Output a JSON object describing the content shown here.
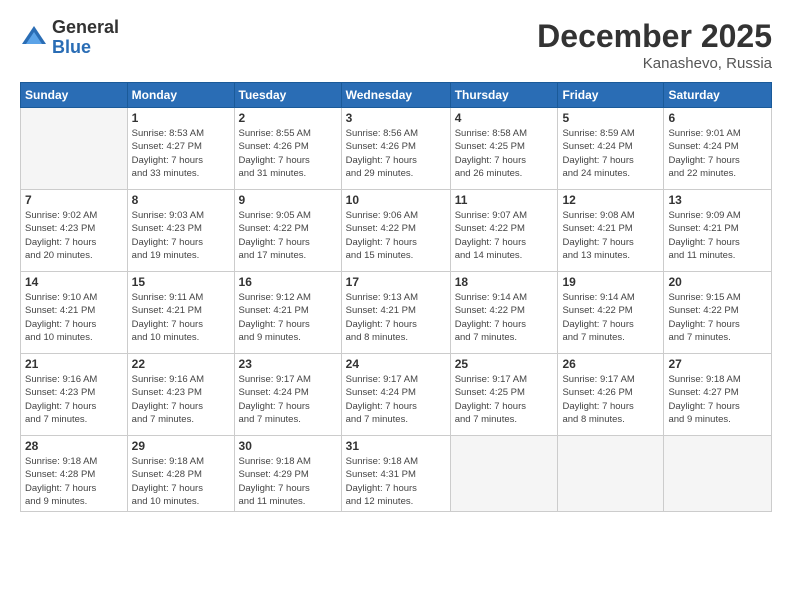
{
  "logo": {
    "general": "General",
    "blue": "Blue"
  },
  "title": "December 2025",
  "location": "Kanashevo, Russia",
  "days_header": [
    "Sunday",
    "Monday",
    "Tuesday",
    "Wednesday",
    "Thursday",
    "Friday",
    "Saturday"
  ],
  "weeks": [
    [
      {
        "num": "",
        "info": ""
      },
      {
        "num": "1",
        "info": "Sunrise: 8:53 AM\nSunset: 4:27 PM\nDaylight: 7 hours\nand 33 minutes."
      },
      {
        "num": "2",
        "info": "Sunrise: 8:55 AM\nSunset: 4:26 PM\nDaylight: 7 hours\nand 31 minutes."
      },
      {
        "num": "3",
        "info": "Sunrise: 8:56 AM\nSunset: 4:26 PM\nDaylight: 7 hours\nand 29 minutes."
      },
      {
        "num": "4",
        "info": "Sunrise: 8:58 AM\nSunset: 4:25 PM\nDaylight: 7 hours\nand 26 minutes."
      },
      {
        "num": "5",
        "info": "Sunrise: 8:59 AM\nSunset: 4:24 PM\nDaylight: 7 hours\nand 24 minutes."
      },
      {
        "num": "6",
        "info": "Sunrise: 9:01 AM\nSunset: 4:24 PM\nDaylight: 7 hours\nand 22 minutes."
      }
    ],
    [
      {
        "num": "7",
        "info": "Sunrise: 9:02 AM\nSunset: 4:23 PM\nDaylight: 7 hours\nand 20 minutes."
      },
      {
        "num": "8",
        "info": "Sunrise: 9:03 AM\nSunset: 4:23 PM\nDaylight: 7 hours\nand 19 minutes."
      },
      {
        "num": "9",
        "info": "Sunrise: 9:05 AM\nSunset: 4:22 PM\nDaylight: 7 hours\nand 17 minutes."
      },
      {
        "num": "10",
        "info": "Sunrise: 9:06 AM\nSunset: 4:22 PM\nDaylight: 7 hours\nand 15 minutes."
      },
      {
        "num": "11",
        "info": "Sunrise: 9:07 AM\nSunset: 4:22 PM\nDaylight: 7 hours\nand 14 minutes."
      },
      {
        "num": "12",
        "info": "Sunrise: 9:08 AM\nSunset: 4:21 PM\nDaylight: 7 hours\nand 13 minutes."
      },
      {
        "num": "13",
        "info": "Sunrise: 9:09 AM\nSunset: 4:21 PM\nDaylight: 7 hours\nand 11 minutes."
      }
    ],
    [
      {
        "num": "14",
        "info": "Sunrise: 9:10 AM\nSunset: 4:21 PM\nDaylight: 7 hours\nand 10 minutes."
      },
      {
        "num": "15",
        "info": "Sunrise: 9:11 AM\nSunset: 4:21 PM\nDaylight: 7 hours\nand 10 minutes."
      },
      {
        "num": "16",
        "info": "Sunrise: 9:12 AM\nSunset: 4:21 PM\nDaylight: 7 hours\nand 9 minutes."
      },
      {
        "num": "17",
        "info": "Sunrise: 9:13 AM\nSunset: 4:21 PM\nDaylight: 7 hours\nand 8 minutes."
      },
      {
        "num": "18",
        "info": "Sunrise: 9:14 AM\nSunset: 4:22 PM\nDaylight: 7 hours\nand 7 minutes."
      },
      {
        "num": "19",
        "info": "Sunrise: 9:14 AM\nSunset: 4:22 PM\nDaylight: 7 hours\nand 7 minutes."
      },
      {
        "num": "20",
        "info": "Sunrise: 9:15 AM\nSunset: 4:22 PM\nDaylight: 7 hours\nand 7 minutes."
      }
    ],
    [
      {
        "num": "21",
        "info": "Sunrise: 9:16 AM\nSunset: 4:23 PM\nDaylight: 7 hours\nand 7 minutes."
      },
      {
        "num": "22",
        "info": "Sunrise: 9:16 AM\nSunset: 4:23 PM\nDaylight: 7 hours\nand 7 minutes."
      },
      {
        "num": "23",
        "info": "Sunrise: 9:17 AM\nSunset: 4:24 PM\nDaylight: 7 hours\nand 7 minutes."
      },
      {
        "num": "24",
        "info": "Sunrise: 9:17 AM\nSunset: 4:24 PM\nDaylight: 7 hours\nand 7 minutes."
      },
      {
        "num": "25",
        "info": "Sunrise: 9:17 AM\nSunset: 4:25 PM\nDaylight: 7 hours\nand 7 minutes."
      },
      {
        "num": "26",
        "info": "Sunrise: 9:17 AM\nSunset: 4:26 PM\nDaylight: 7 hours\nand 8 minutes."
      },
      {
        "num": "27",
        "info": "Sunrise: 9:18 AM\nSunset: 4:27 PM\nDaylight: 7 hours\nand 9 minutes."
      }
    ],
    [
      {
        "num": "28",
        "info": "Sunrise: 9:18 AM\nSunset: 4:28 PM\nDaylight: 7 hours\nand 9 minutes."
      },
      {
        "num": "29",
        "info": "Sunrise: 9:18 AM\nSunset: 4:28 PM\nDaylight: 7 hours\nand 10 minutes."
      },
      {
        "num": "30",
        "info": "Sunrise: 9:18 AM\nSunset: 4:29 PM\nDaylight: 7 hours\nand 11 minutes."
      },
      {
        "num": "31",
        "info": "Sunrise: 9:18 AM\nSunset: 4:31 PM\nDaylight: 7 hours\nand 12 minutes."
      },
      {
        "num": "",
        "info": ""
      },
      {
        "num": "",
        "info": ""
      },
      {
        "num": "",
        "info": ""
      }
    ]
  ]
}
